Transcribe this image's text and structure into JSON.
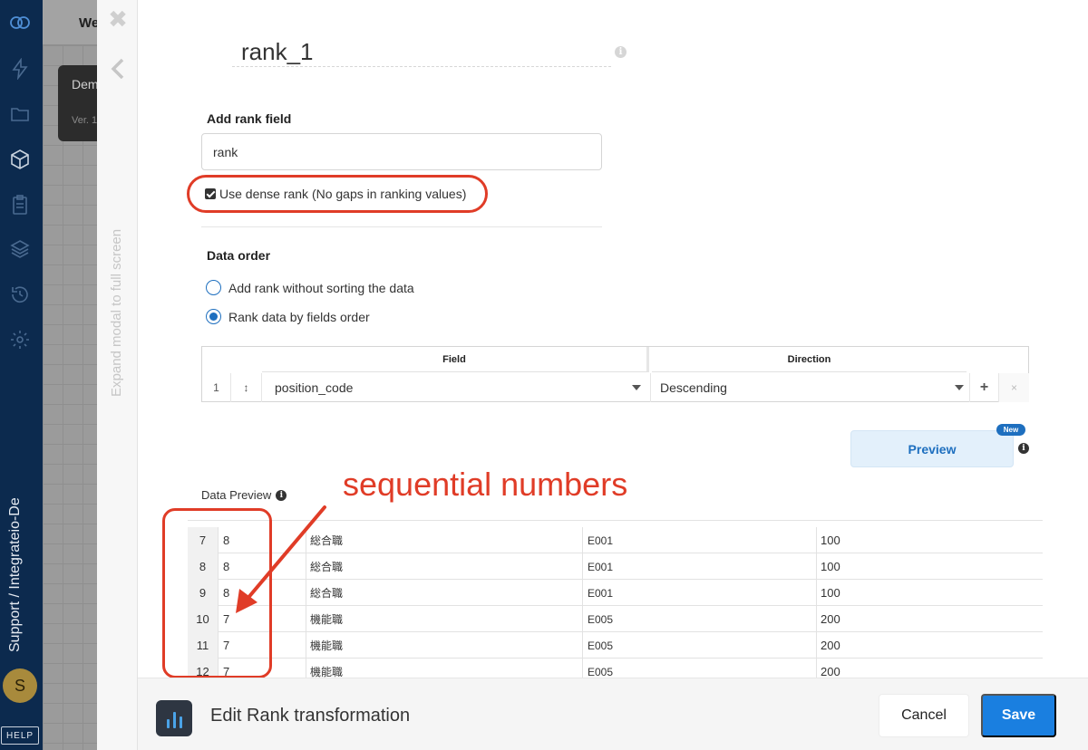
{
  "sidebar": {
    "icons": [
      "logo-icon",
      "bolt-icon",
      "folder-icon",
      "package-icon",
      "clipboard-icon",
      "layers-icon",
      "history-icon",
      "gear-icon"
    ],
    "workspace_label": "Support / Integrateio-De",
    "avatar_initial": "S",
    "help_label": "HELP"
  },
  "background_app": {
    "tab_label": "We",
    "card_title": "Dem",
    "card_version": "Ver. 1"
  },
  "modal_strip": {
    "close_icon": "close-icon",
    "collapse_icon": "chevron-left-icon",
    "expand_label": "Expand modal to full screen"
  },
  "component": {
    "name": "rank_1"
  },
  "rank_field": {
    "title": "Add rank field",
    "value": "rank",
    "dense_rank_label": "Use dense rank (No gaps in ranking values)",
    "dense_rank_checked": true
  },
  "data_order": {
    "title": "Data order",
    "options": [
      {
        "label": "Add rank without sorting the data",
        "checked": false
      },
      {
        "label": "Rank data by fields order",
        "checked": true
      }
    ]
  },
  "order_table": {
    "headers": {
      "field": "Field",
      "direction": "Direction"
    },
    "rows": [
      {
        "index": "1",
        "drag": "↕",
        "field": "position_code",
        "direction": "Descending",
        "add": "+",
        "remove": "×"
      }
    ]
  },
  "preview": {
    "button_label": "Preview",
    "badge": "New",
    "data_preview_label": "Data Preview"
  },
  "annotation": {
    "text": "sequential numbers",
    "color": "#e03c27"
  },
  "preview_table": {
    "rows": [
      {
        "idx": "7",
        "rank": "8",
        "c1": "総合職",
        "c2": "E001",
        "c3": "100"
      },
      {
        "idx": "8",
        "rank": "8",
        "c1": "総合職",
        "c2": "E001",
        "c3": "100"
      },
      {
        "idx": "9",
        "rank": "8",
        "c1": "総合職",
        "c2": "E001",
        "c3": "100"
      },
      {
        "idx": "10",
        "rank": "7",
        "c1": "機能職",
        "c2": "E005",
        "c3": "200"
      },
      {
        "idx": "11",
        "rank": "7",
        "c1": "機能職",
        "c2": "E005",
        "c3": "200"
      },
      {
        "idx": "12",
        "rank": "7",
        "c1": "機能職",
        "c2": "E005",
        "c3": "200"
      }
    ]
  },
  "footer": {
    "icon": "bar-chart-icon",
    "title": "Edit Rank transformation",
    "cancel_label": "Cancel",
    "save_label": "Save"
  },
  "colors": {
    "sidebar": "#0c2a4e",
    "primary": "#1a7fe0",
    "annotation": "#e03c27"
  }
}
